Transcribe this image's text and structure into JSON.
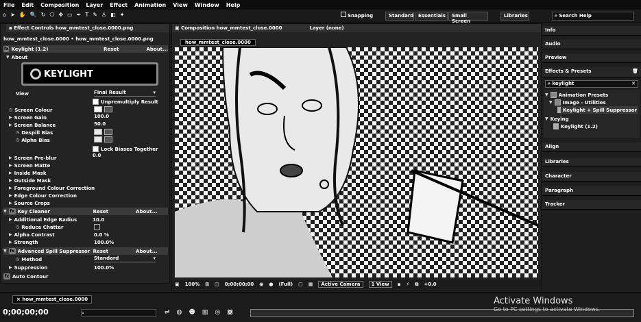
{
  "menu": [
    "File",
    "Edit",
    "Composition",
    "Layer",
    "Effect",
    "Animation",
    "View",
    "Window",
    "Help"
  ],
  "toolbar": {
    "snapping": "Snapping",
    "workspaces": [
      "Essentials",
      "Standard",
      "Small Screen",
      "Libraries"
    ],
    "search_placeholder": "Search Help"
  },
  "effect_controls": {
    "tab": "Effect Controls how_mmtest_close.0000.png",
    "breadcrumb": "how_mmtest_close.0000 • how_mmtest_close.0000.png",
    "effect_name": "Keylight (1.2)",
    "reset": "Reset",
    "about": "About...",
    "about_section": "About",
    "logo_text": "KEYLIGHT",
    "view_label": "View",
    "view_value": "Final Result",
    "unpremultiply": "Unpremultiply Result",
    "params": [
      {
        "label": "Screen Colour",
        "value": ""
      },
      {
        "label": "Screen Gain",
        "value": "100.0"
      },
      {
        "label": "Screen Balance",
        "value": "50.0"
      },
      {
        "label": "Despill Bias",
        "value": ""
      },
      {
        "label": "Alpha Bias",
        "value": ""
      }
    ],
    "lock_biases": "Lock Biases Together",
    "pre_blur_label": "Screen Pre-blur",
    "pre_blur_value": "0.0",
    "groups": [
      "Screen Matte",
      "Inside Mask",
      "Outside Mask",
      "Foreground Colour Correction",
      "Edge Colour Correction",
      "Source Crops"
    ],
    "key_cleaner": {
      "name": "Key Cleaner",
      "reset": "Reset",
      "about": "About...",
      "params": [
        {
          "label": "Additional Edge Radius",
          "value": "10.0"
        },
        {
          "label": "Reduce Chatter",
          "value": ""
        },
        {
          "label": "Alpha Contrast",
          "value": "0.0 %"
        },
        {
          "label": "Strength",
          "value": "100.0%"
        }
      ]
    },
    "spill": {
      "name": "Advanced Spill Suppressor",
      "reset": "Reset",
      "about": "About...",
      "method_label": "Method",
      "method_value": "Standard",
      "suppression_label": "Suppression",
      "suppression_value": "100.0%"
    },
    "last": "Auto Contour"
  },
  "composition": {
    "tab": "Composition how_mmtest_close.0000",
    "layer_tab": "Layer (none)",
    "sub_tab": "how_mmtest_close.0000",
    "footer": {
      "zoom": "100%",
      "timecode": "0;00;00;00",
      "resolution": "(Full)",
      "camera": "Active Camera",
      "views": "1 View",
      "exposure": "+0.0"
    }
  },
  "right_panel": {
    "sections": [
      "Info",
      "Audio",
      "Preview"
    ],
    "effects_title": "Effects & Presets",
    "search_value": "keylight",
    "tree": [
      {
        "label": "Animation Presets",
        "level": 0
      },
      {
        "label": "Image - Utilities",
        "level": 1
      },
      {
        "label": "Keylight + Spill Suppressor",
        "level": 2
      },
      {
        "label": "Keying",
        "level": 0
      },
      {
        "label": "Keylight (1.2)",
        "level": 1
      }
    ],
    "sections2": [
      "Align",
      "Libraries",
      "Character",
      "Paragraph",
      "Tracker"
    ]
  },
  "timeline": {
    "tab": "how_mmtest_close.0000",
    "timecode": "0;00;00;00"
  },
  "watermark": {
    "title": "Activate Windows",
    "subtitle": "Go to PC settings to activate Windows."
  }
}
